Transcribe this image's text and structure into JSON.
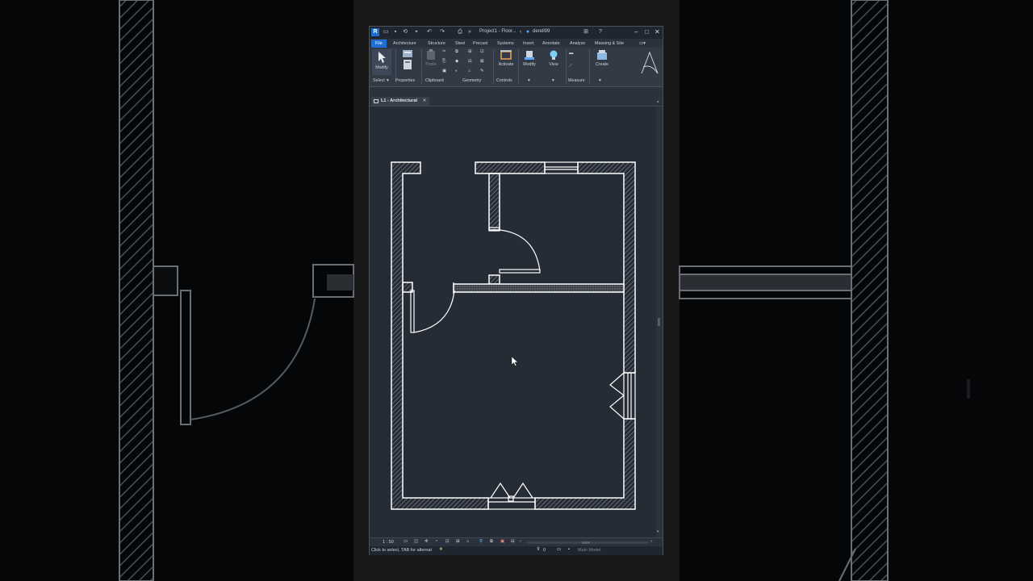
{
  "app": {
    "title": "Project1 - Floor...",
    "user": "derell99",
    "logo": "R",
    "brand": "A"
  },
  "ribbon_tabs": [
    "File",
    "Architecture",
    "Structure",
    "Steel",
    "Precast",
    "Systems",
    "Insert",
    "Annotate",
    "Analyze",
    "Massing & Site"
  ],
  "ribbon": {
    "modify": "Modify",
    "activate": "Activate",
    "modify2": "Modify",
    "view": "View",
    "create": "Create",
    "paste": "Paste",
    "panels": {
      "select": "Select",
      "properties": "Properties",
      "clipboard": "Clipboard",
      "geometry": "Geometry",
      "controls": "Controls",
      "measure": "Measure"
    }
  },
  "view_tab": {
    "label": "L1 - Architectural"
  },
  "status": {
    "scale": "1 : 50",
    "hint": "Click to select, TAB for alternat",
    "selection_count": "0",
    "model": "Main Model"
  },
  "colors": {
    "accent": "#1f6fd1",
    "drawing_bg": "#262c36",
    "wall_line": "#ffffff"
  }
}
